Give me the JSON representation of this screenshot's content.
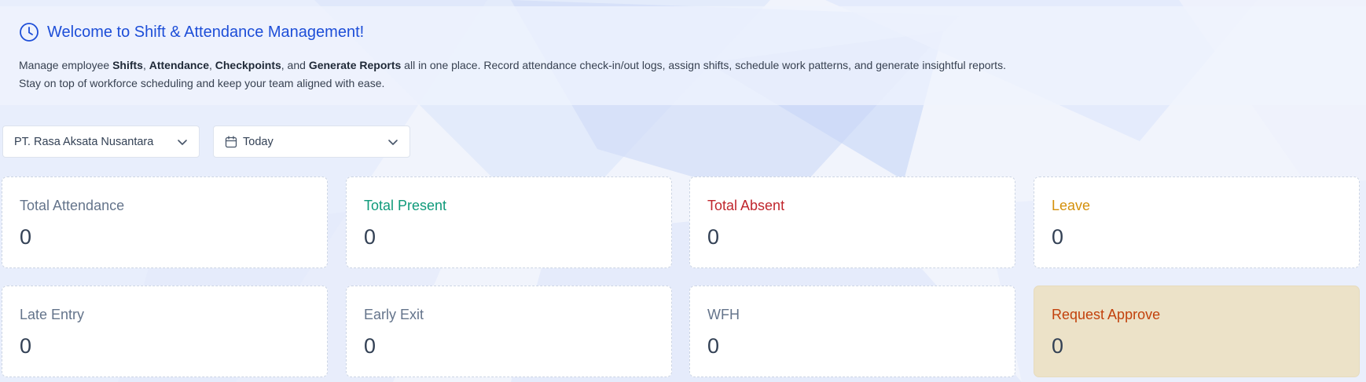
{
  "welcome": {
    "title": "Welcome to Shift & Attendance Management!",
    "desc": {
      "t1": "Manage employee ",
      "b1": "Shifts",
      "t2": ", ",
      "b2": "Attendance",
      "t3": ", ",
      "b3": "Checkpoints",
      "t4": ", and ",
      "b4": "Generate Reports",
      "t5": " all in one place. Record attendance check-in/out logs, assign shifts, schedule work patterns, and generate insightful reports.",
      "line2": "Stay on top of workforce scheduling and keep your team aligned with ease."
    },
    "icon": "clock-icon"
  },
  "filters": {
    "company": {
      "value": "PT. Rasa Aksata Nusantara",
      "icon": "chevron-down-icon"
    },
    "date": {
      "value": "Today",
      "icon": "calendar-icon"
    }
  },
  "cards": [
    {
      "label": "Total Attendance",
      "value": "0",
      "color": "#64748b"
    },
    {
      "label": "Total Present",
      "value": "0",
      "color": "#0f9a7a"
    },
    {
      "label": "Total Absent",
      "value": "0",
      "color": "#c0262d"
    },
    {
      "label": "Leave",
      "value": "0",
      "color": "#d4900a"
    },
    {
      "label": "Late Entry",
      "value": "0",
      "color": "#64748b"
    },
    {
      "label": "Early Exit",
      "value": "0",
      "color": "#64748b"
    },
    {
      "label": "WFH",
      "value": "0",
      "color": "#64748b"
    },
    {
      "label": "Request Approve",
      "value": "0",
      "color": "#c2410c"
    }
  ],
  "colors": {
    "accent": "#1d4ed8",
    "approve_bg": "#ece2c8"
  }
}
